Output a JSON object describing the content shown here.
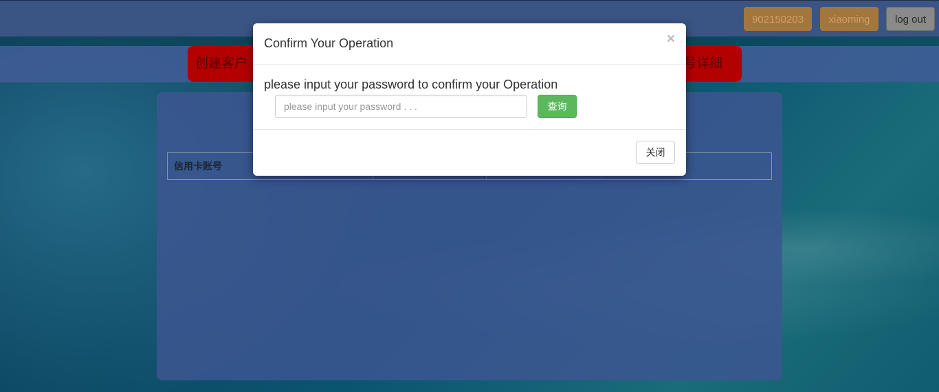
{
  "header": {
    "account_number": "902150203",
    "username": "xiaoming",
    "logout_label": "log out"
  },
  "nav": {
    "left_button_visible_text": "创建客户",
    "right_button_visible_text": "号详细"
  },
  "table": {
    "columns": [
      "信用卡账号",
      "",
      "",
      ""
    ]
  },
  "modal": {
    "title": "Confirm Your Operation",
    "close_symbol": "×",
    "prompt": "please input your password to confirm your Operation",
    "password_placeholder": "please input your password . . .",
    "submit_label": "查询",
    "close_label": "关闭"
  },
  "colors": {
    "header_bg": "#3a5484",
    "badge_orange": "#a3773b",
    "nav_red": "#b30000",
    "submit_green": "#5cb85c"
  }
}
